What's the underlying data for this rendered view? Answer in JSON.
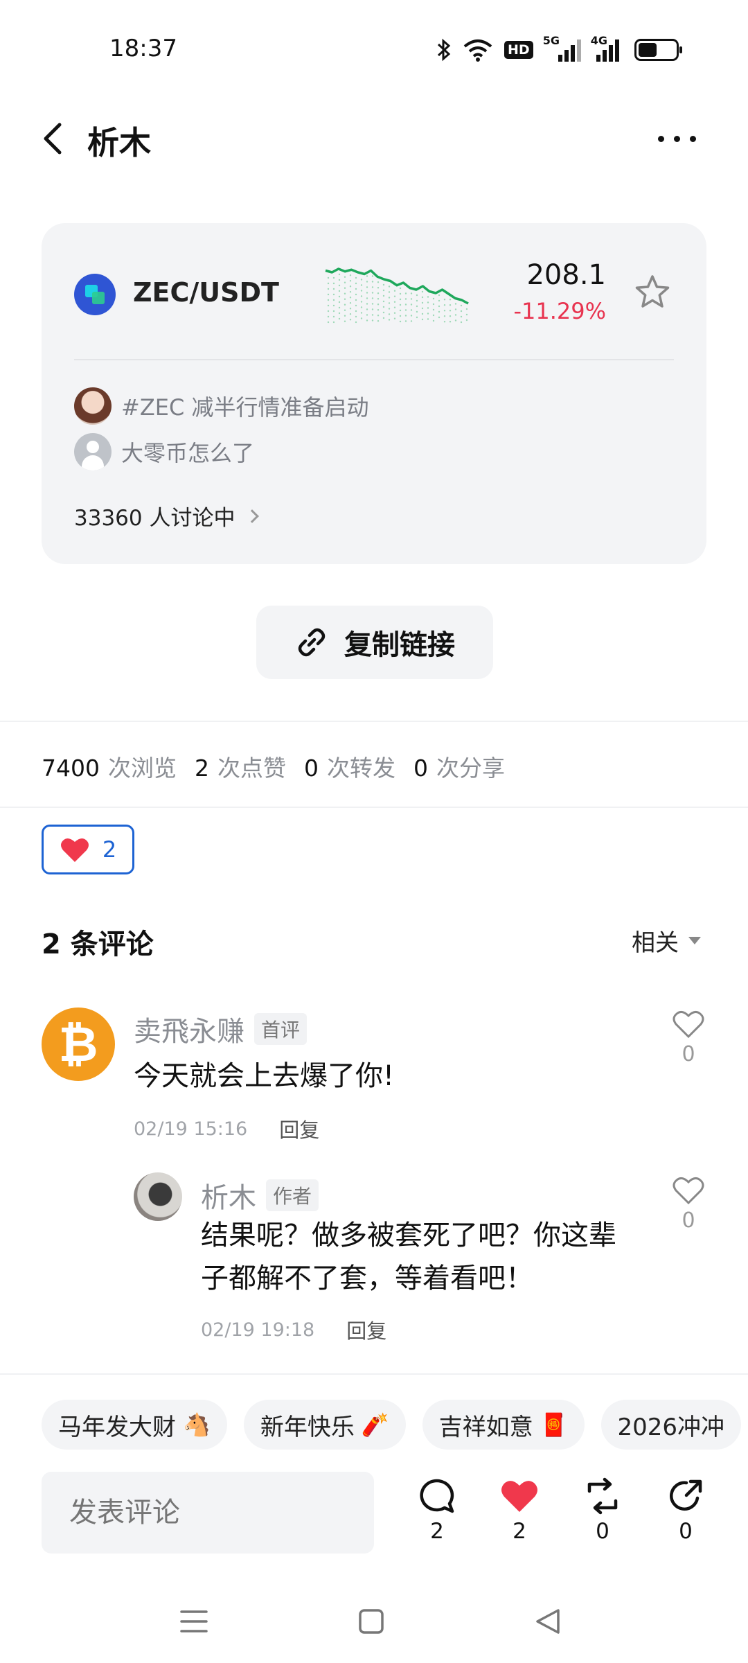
{
  "status_bar": {
    "time": "18:37",
    "network_badge": "HD",
    "signal1_label": "5G",
    "signal2_label": "4G",
    "icons": [
      "bluetooth-icon",
      "wifi-icon",
      "hd-badge",
      "signal-5g-icon",
      "signal-4g-icon",
      "battery-icon"
    ]
  },
  "header": {
    "title": "析木",
    "back_icon": "chevron-left-icon",
    "more_icon": "more-dots-icon"
  },
  "market_card": {
    "pair": "ZEC/USDT",
    "price": "208.1",
    "change": "-11.29%",
    "change_color": "#e8334f",
    "sparkline_color": "#1fa85c",
    "sparkline": [
      62,
      60,
      64,
      61,
      63,
      60,
      58,
      62,
      55,
      52,
      50,
      45,
      48,
      42,
      40,
      44,
      38,
      36,
      40,
      35,
      30,
      28,
      24
    ],
    "topics": [
      {
        "text": "#ZEC 减半行情准备启动"
      },
      {
        "text": "大零币怎么了"
      }
    ],
    "discussion": "33360 人讨论中"
  },
  "copy_link": {
    "label": "复制链接"
  },
  "stats": [
    {
      "num": "7400",
      "label": "次浏览"
    },
    {
      "num": "2",
      "label": "次点赞"
    },
    {
      "num": "0",
      "label": "次转发"
    },
    {
      "num": "0",
      "label": "次分享"
    }
  ],
  "like_pill": {
    "count": "2"
  },
  "comments": {
    "title": "2 条评论",
    "sort": "相关",
    "items": [
      {
        "user": "卖飛永赚",
        "tag": "首评",
        "text": "今天就会上去爆了你!",
        "time": "02/19 15:16",
        "reply_label": "回复",
        "likes": "0",
        "avatar_glyph": "₿"
      },
      {
        "user": "析木",
        "tag": "作者",
        "text_line1": "结果呢？做多被套死了吧？你这辈",
        "text_line2": "子都解不了套，等着看吧！",
        "time": "02/19 19:18",
        "reply_label": "回复",
        "likes": "0"
      }
    ]
  },
  "chips": [
    {
      "label": "马年发大财",
      "emoji": "🐴"
    },
    {
      "label": "新年快乐",
      "emoji": "🧨"
    },
    {
      "label": "吉祥如意",
      "emoji": "🧧"
    },
    {
      "label": "2026冲冲",
      "emoji": ""
    }
  ],
  "bottom_bar": {
    "input_placeholder": "发表评论",
    "comment_count": "2",
    "like_count": "2",
    "repost_count": "0",
    "share_count": "0"
  },
  "colors": {
    "accent_blue": "#1d63d3",
    "heart_red": "#f0384c",
    "coin_blue": "#2f55d4",
    "btc_orange": "#f39c1e"
  }
}
